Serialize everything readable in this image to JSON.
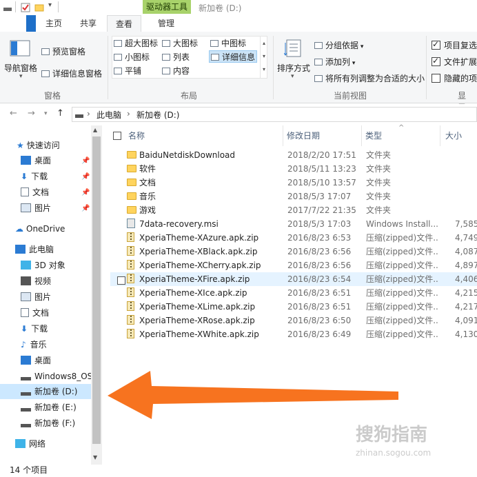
{
  "titlebar": {
    "tool_tab": "驱动器工具",
    "window_title": "新加卷 (D:)"
  },
  "tabs": [
    {
      "label": "主页"
    },
    {
      "label": "共享"
    },
    {
      "label": "查看"
    },
    {
      "label": "管理"
    }
  ],
  "ribbon": {
    "panes": {
      "nav_pane": "导航窗格",
      "preview": "预览窗格",
      "details": "详细信息窗格",
      "group": "窗格"
    },
    "layout": {
      "items": [
        "超大图标",
        "大图标",
        "中图标",
        "小图标",
        "列表",
        "详细信息",
        "平铺",
        "内容"
      ],
      "group": "布局"
    },
    "current_view": {
      "sort": "排序方式",
      "group_by": "分组依据",
      "add_column": "添加列",
      "fit_columns": "将所有列调整为合适的大小",
      "group": "当前视图"
    },
    "show_hide": {
      "item_checkbox": "项目复选",
      "file_ext": "文件扩展",
      "hidden": "隐藏的项",
      "group": "显示/"
    }
  },
  "address": {
    "crumbs": [
      "此电脑",
      "新加卷 (D:)"
    ]
  },
  "sidebar": {
    "items": [
      {
        "label": "快速访问"
      },
      {
        "label": "桌面"
      },
      {
        "label": "下载"
      },
      {
        "label": "文档"
      },
      {
        "label": "图片"
      },
      {
        "label": "OneDrive"
      },
      {
        "label": "此电脑"
      },
      {
        "label": "3D 对象"
      },
      {
        "label": "视频"
      },
      {
        "label": "图片"
      },
      {
        "label": "文档"
      },
      {
        "label": "下载"
      },
      {
        "label": "音乐"
      },
      {
        "label": "桌面"
      },
      {
        "label": "Windows8_OS"
      },
      {
        "label": "新加卷 (D:)"
      },
      {
        "label": "新加卷 (E:)"
      },
      {
        "label": "新加卷 (F:)"
      },
      {
        "label": "网络"
      }
    ]
  },
  "columns": {
    "name": "名称",
    "date": "修改日期",
    "type": "类型",
    "size": "大小"
  },
  "files": [
    {
      "name": "BaiduNetdiskDownload",
      "date": "2018/2/20 17:51",
      "type": "文件夹",
      "size": "",
      "icon": "folder-icon"
    },
    {
      "name": "软件",
      "date": "2018/5/11 13:23",
      "type": "文件夹",
      "size": "",
      "icon": "folder-icon"
    },
    {
      "name": "文档",
      "date": "2018/5/10 13:57",
      "type": "文件夹",
      "size": "",
      "icon": "folder-icon"
    },
    {
      "name": "音乐",
      "date": "2018/5/3 17:07",
      "type": "文件夹",
      "size": "",
      "icon": "folder-icon"
    },
    {
      "name": "游戏",
      "date": "2017/7/22 21:35",
      "type": "文件夹",
      "size": "",
      "icon": "folder-icon"
    },
    {
      "name": "7data-recovery.msi",
      "date": "2018/5/3 17:03",
      "type": "Windows Install...",
      "size": "7,585",
      "icon": "msi-icon"
    },
    {
      "name": "XperiaTheme-XAzure.apk.zip",
      "date": "2016/8/23 6:53",
      "type": "压缩(zipped)文件...",
      "size": "4,749",
      "icon": "zip-icon"
    },
    {
      "name": "XperiaTheme-XBlack.apk.zip",
      "date": "2016/8/23 6:56",
      "type": "压缩(zipped)文件...",
      "size": "4,087",
      "icon": "zip-icon"
    },
    {
      "name": "XperiaTheme-XCherry.apk.zip",
      "date": "2016/8/23 6:56",
      "type": "压缩(zipped)文件...",
      "size": "4,897",
      "icon": "zip-icon"
    },
    {
      "name": "XperiaTheme-XFire.apk.zip",
      "date": "2016/8/23 6:54",
      "type": "压缩(zipped)文件...",
      "size": "4,406",
      "icon": "zip-icon"
    },
    {
      "name": "XperiaTheme-XIce.apk.zip",
      "date": "2016/8/23 6:51",
      "type": "压缩(zipped)文件...",
      "size": "4,215",
      "icon": "zip-icon"
    },
    {
      "name": "XperiaTheme-XLime.apk.zip",
      "date": "2016/8/23 6:51",
      "type": "压缩(zipped)文件...",
      "size": "4,217",
      "icon": "zip-icon"
    },
    {
      "name": "XperiaTheme-XRose.apk.zip",
      "date": "2016/8/23 6:50",
      "type": "压缩(zipped)文件...",
      "size": "4,091",
      "icon": "zip-icon"
    },
    {
      "name": "XperiaTheme-XWhite.apk.zip",
      "date": "2016/8/23 6:49",
      "type": "压缩(zipped)文件...",
      "size": "4,130",
      "icon": "zip-icon"
    }
  ],
  "status": {
    "count": "14 个项目"
  },
  "watermark": {
    "text": "搜狗指南",
    "url": "zhinan.sogou.com"
  },
  "colors": {
    "tool_tab": "#a8d26a",
    "selection": "#cce8ff",
    "arrow": "#f7731f"
  }
}
